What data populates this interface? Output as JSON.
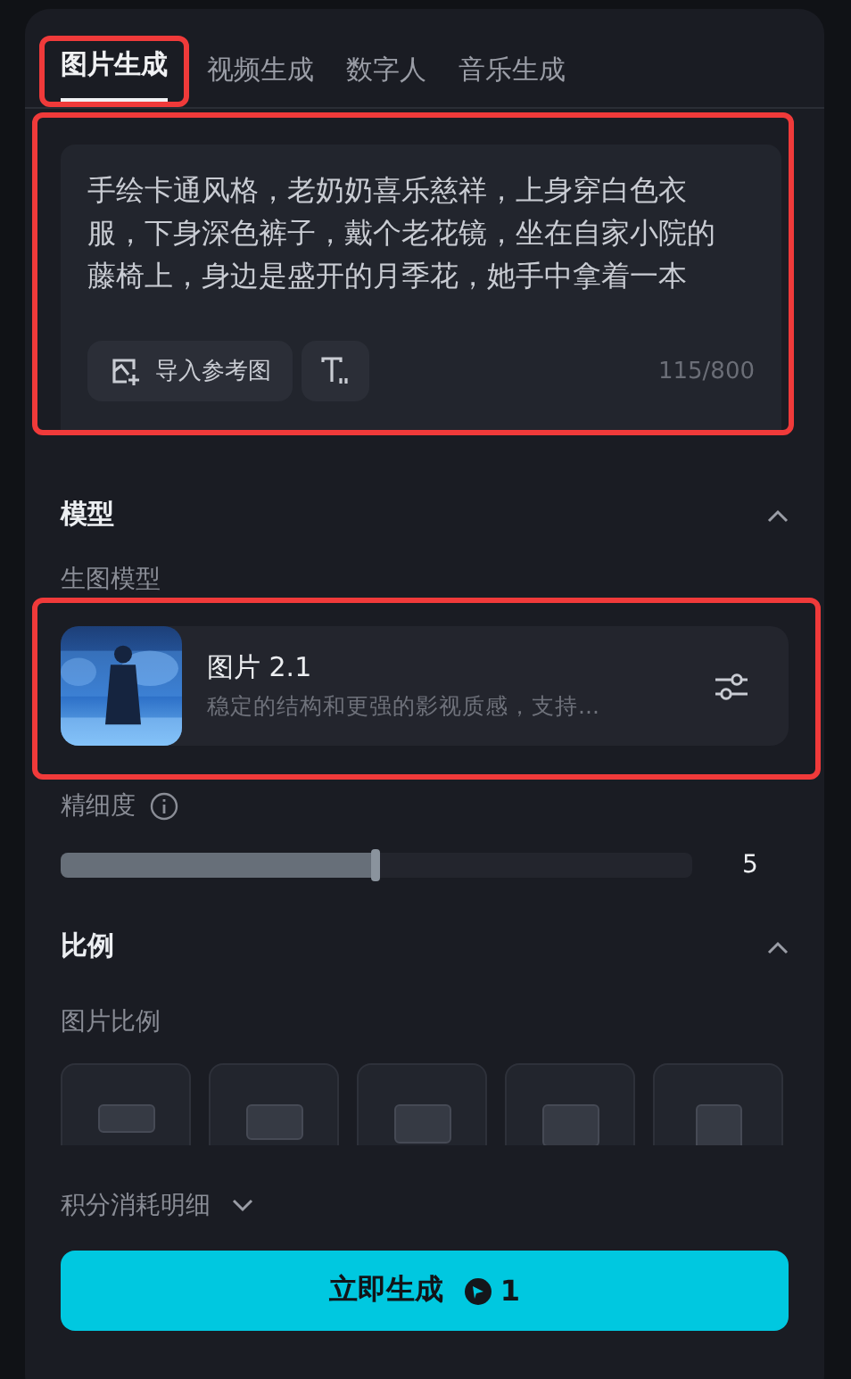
{
  "tabs": [
    {
      "label": "图片生成",
      "selected": true,
      "highlighted": true
    },
    {
      "label": "视频生成",
      "selected": false,
      "highlighted": false
    },
    {
      "label": "数字人",
      "selected": false,
      "highlighted": false
    },
    {
      "label": "音乐生成",
      "selected": false,
      "highlighted": false
    }
  ],
  "prompt": {
    "highlighted": true,
    "text": "手绘卡通风格，老奶奶喜乐慈祥，上身穿白色衣服，下身深色裤子，戴个老花镜，坐在自家小院的藤椅上，身边是盛开的月季花，她手中拿着一本",
    "reference_button": "导入参考图",
    "counter": "115/800"
  },
  "model_section": {
    "title": "模型",
    "expanded": true,
    "label": "生图模型",
    "model": {
      "highlighted": true,
      "kind": "picture",
      "name": "图片 2.1",
      "description": "稳定的结构和更强的影视质感，支持..."
    }
  },
  "detail": {
    "label": "精细度",
    "level": 0.5,
    "reading": "5"
  },
  "ratio_section": {
    "title": "比例",
    "expanded": true,
    "label": "图片比例"
  },
  "cost_details": {
    "label": "积分消耗明细",
    "expanded": false
  },
  "generate_button": {
    "label": "立即生成",
    "cost": "1"
  }
}
